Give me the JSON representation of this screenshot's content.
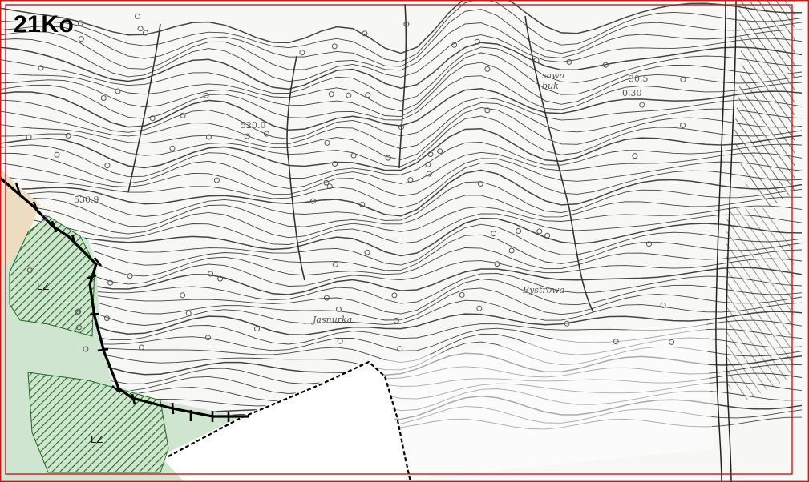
{
  "map": {
    "sheet_label": "21Ko",
    "zones": [
      {
        "id": "lz-upper",
        "label": "LZ",
        "fill": "#2f7a2f"
      },
      {
        "id": "lz-lower",
        "label": "LZ",
        "fill": "#2f7a2f"
      }
    ],
    "place_labels": [
      "Jasnurka",
      "Bystrowa",
      "sawa buk",
      "530.9",
      "520.0",
      "30.5",
      "0.30"
    ],
    "colors": {
      "frame": "#d01818",
      "contour": "#444444",
      "forest_hatch": "#1f6b1f",
      "forest_fill": "#cfe5cf",
      "boundary": "#000000",
      "tan_area": "#ecdcc0"
    }
  }
}
